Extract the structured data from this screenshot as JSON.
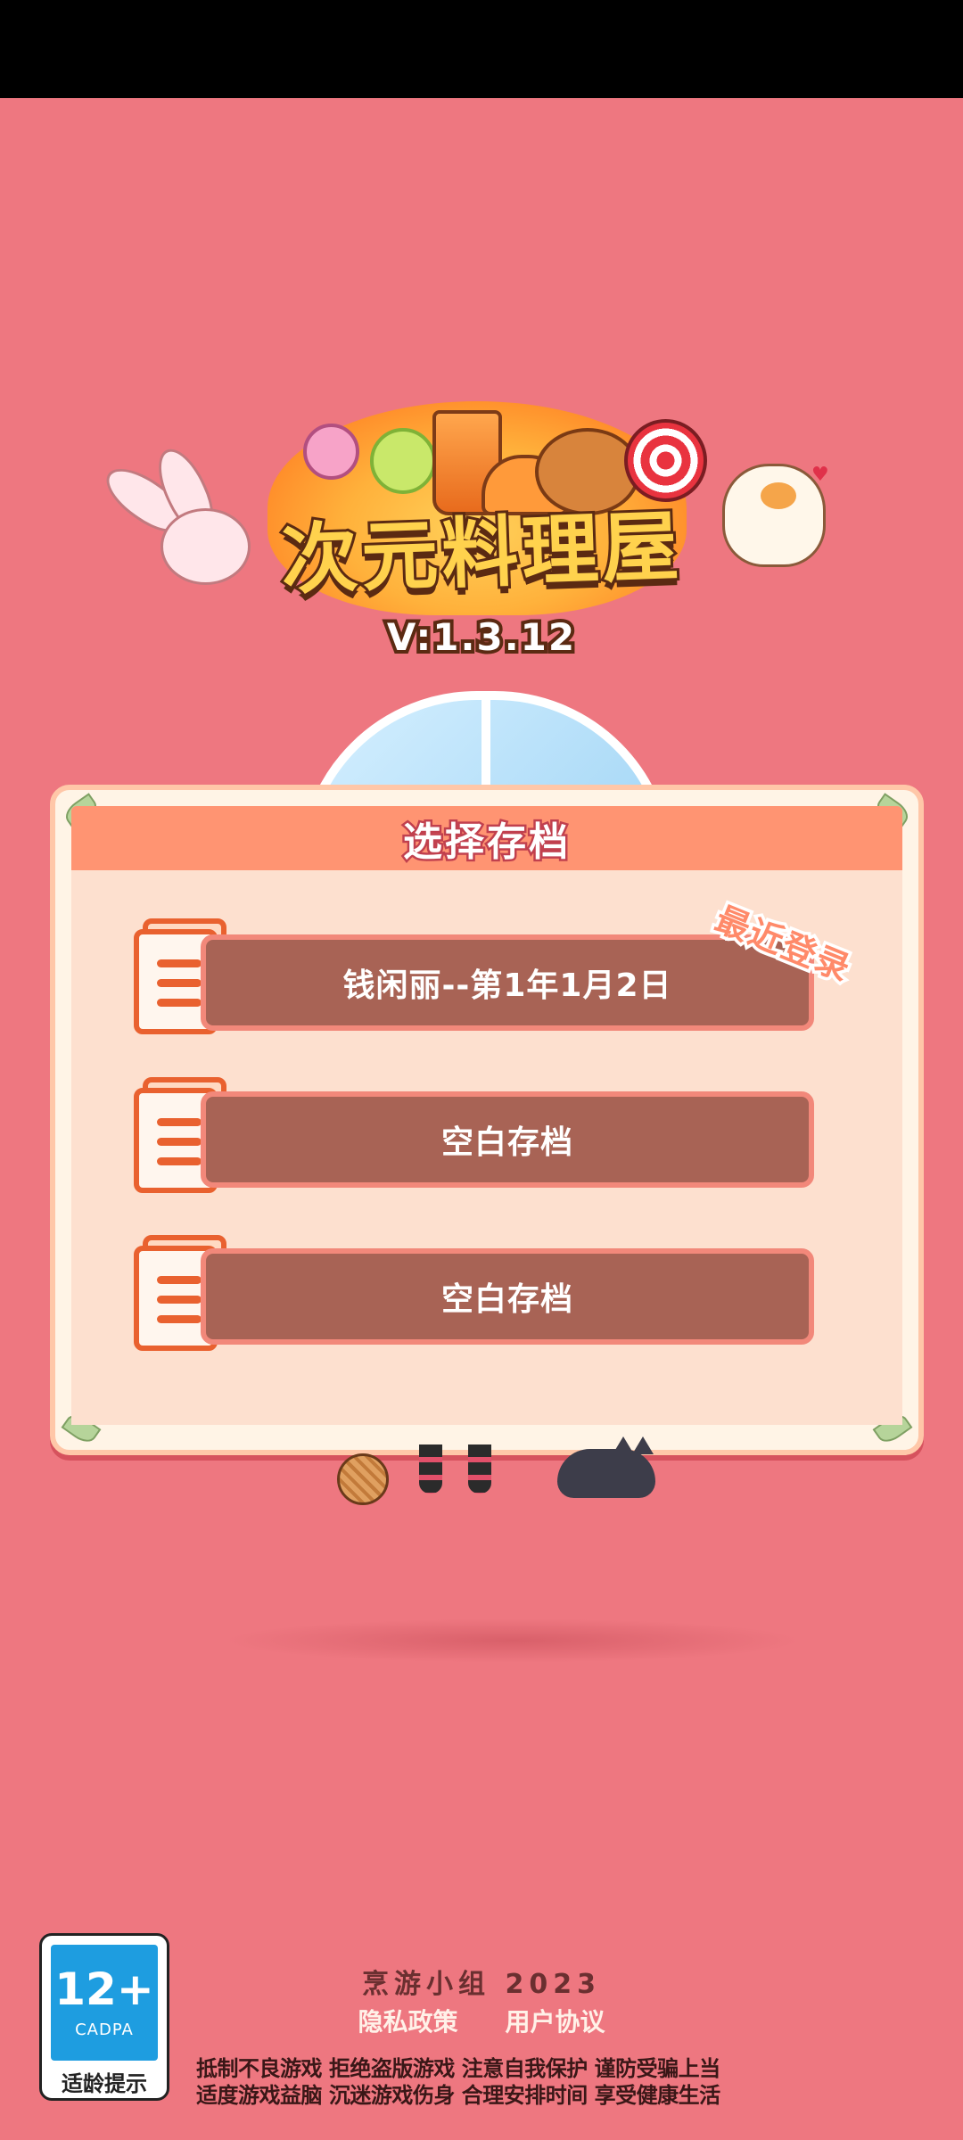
{
  "logo": {
    "title": "次元料理屋"
  },
  "version": "V:1.3.12",
  "dialog": {
    "title": "选择存档",
    "slots": [
      {
        "label": "钱闲丽--第1年1月2日"
      },
      {
        "label": "空白存档"
      },
      {
        "label": "空白存档"
      }
    ],
    "recent_badge": "最近登录"
  },
  "footer": {
    "age_rating": {
      "number": "12+",
      "org": "CADPA",
      "tip": "适龄提示"
    },
    "studio": "烹游小组 2023",
    "privacy_link": "隐私政策",
    "agreement_link": "用户协议",
    "notice_line1": "抵制不良游戏 拒绝盗版游戏 注意自我保护 谨防受骗上当",
    "notice_line2": "适度游戏益脑 沉迷游戏伤身 合理安排时间 享受健康生活"
  },
  "colors": {
    "background": "#ee7780",
    "dialog_header": "#ff9472",
    "slot": "#a86355",
    "age_badge": "#1e9de0"
  }
}
